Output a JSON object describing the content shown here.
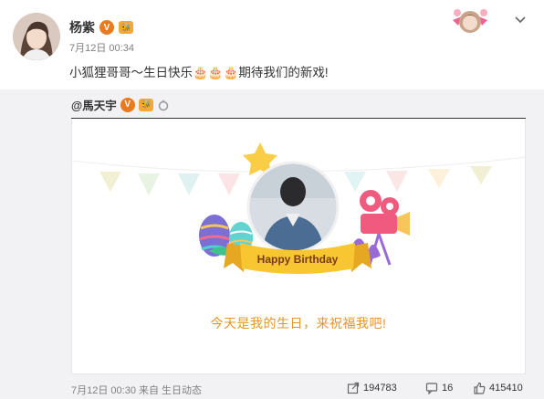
{
  "post": {
    "author": "杨紫",
    "time": "7月12日 00:34",
    "text": "小狐狸哥哥～生日快乐🎂🎂🎂期待我们的新戏!",
    "badges": {
      "verified": "V",
      "medal": "🐝"
    }
  },
  "repost": {
    "author": "@馬天宇",
    "card": {
      "banner_text": "Happy Birthday",
      "title": "今天是我的生日，来祝福我吧!"
    },
    "footer": {
      "date_source": "7月12日 00:30 来自 生日动态",
      "reposts": "194783",
      "comments": "16",
      "likes": "415410"
    }
  },
  "colors": {
    "accent_orange": "#e3962a",
    "verified_orange": "#e87b1d",
    "repost_bg": "#f2f2f5",
    "banner_yellow": "#f7c631"
  }
}
